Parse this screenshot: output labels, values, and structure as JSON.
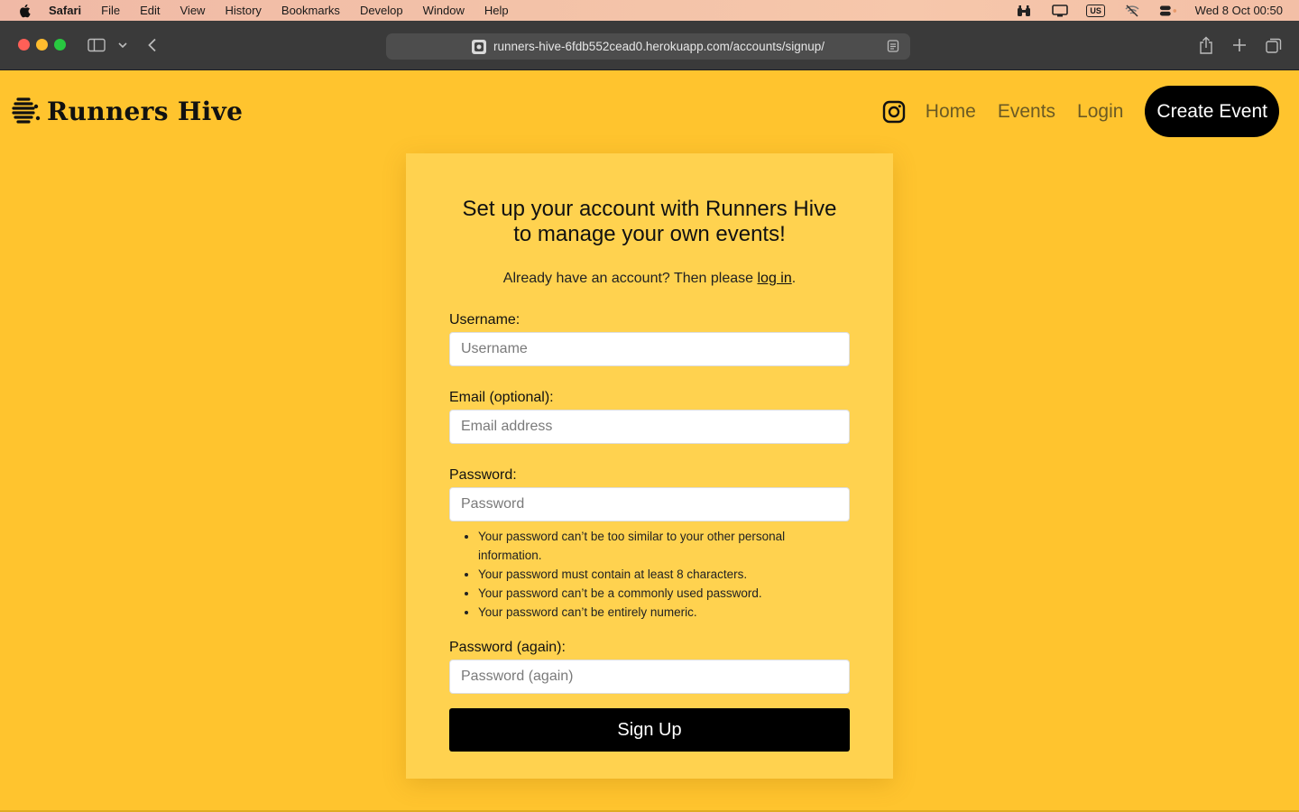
{
  "menubar": {
    "app_name": "Safari",
    "items": [
      "File",
      "Edit",
      "View",
      "History",
      "Bookmarks",
      "Develop",
      "Window",
      "Help"
    ],
    "keyboard_layout": "US",
    "clock": "Wed 8 Oct  00:50",
    "status_icons": [
      "binoculars-icon",
      "display-icon",
      "keyboard-layout-icon",
      "wifi-off-icon",
      "control-center-icon"
    ]
  },
  "browser": {
    "url": "runners-hive-6fdb552cead0.herokuapp.com/accounts/signup/"
  },
  "site": {
    "brand_name": "Runners Hive",
    "nav": {
      "home": "Home",
      "events": "Events",
      "login": "Login",
      "create_event": "Create Event"
    },
    "accent_color": "#ffc42e",
    "card_color": "#ffd24f"
  },
  "signup": {
    "title_line1": "Set up your account with Runners Hive",
    "title_line2": "to manage your own events!",
    "already_text": "Already have an account? Then please ",
    "login_link": "log in",
    "period": ".",
    "username_label": "Username:",
    "username_placeholder": "Username",
    "email_label": "Email (optional):",
    "email_placeholder": "Email address",
    "password_label": "Password:",
    "password_placeholder": "Password",
    "password_hints": [
      "Your password can’t be too similar to your other personal information.",
      "Your password must contain at least 8 characters.",
      "Your password can’t be a commonly used password.",
      "Your password can’t be entirely numeric."
    ],
    "password2_label": "Password (again):",
    "password2_placeholder": "Password (again)",
    "submit_label": "Sign Up"
  }
}
